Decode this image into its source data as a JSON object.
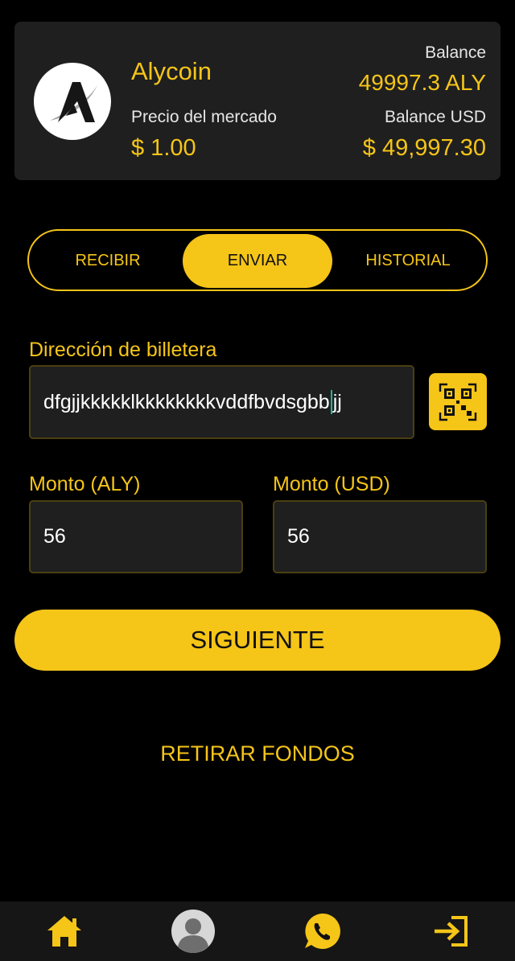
{
  "wallet": {
    "coin_name": "Alycoin",
    "market_price_label": "Precio del mercado",
    "market_price_value": "$ 1.00",
    "balance_label": "Balance",
    "balance_value": "49997.3 ALY",
    "balance_usd_label": "Balance USD",
    "balance_usd_value": "$ 49,997.30",
    "logo_icon": "alycoin-logo-icon"
  },
  "tabs": [
    {
      "label": "RECIBIR",
      "active": false
    },
    {
      "label": "ENVIAR",
      "active": true
    },
    {
      "label": "HISTORIAL",
      "active": false
    }
  ],
  "form": {
    "address_label": "Dirección de billetera",
    "address_before_caret": "dfgjjkkkkklkkkkkkkkvddfbvdsgbb",
    "address_after_caret": "jj",
    "qr_icon": "qr-code-icon",
    "amount_aly_label": "Monto (ALY)",
    "amount_aly_value": "56",
    "amount_usd_label": "Monto (USD)",
    "amount_usd_value": "56"
  },
  "actions": {
    "next_label": "SIGUIENTE",
    "withdraw_label": "RETIRAR FONDOS"
  },
  "bottom_nav": [
    {
      "icon": "home-icon"
    },
    {
      "icon": "profile-avatar-icon"
    },
    {
      "icon": "whatsapp-icon"
    },
    {
      "icon": "logout-icon"
    }
  ],
  "colors": {
    "accent": "#f5c518",
    "background": "#000000",
    "card": "#1f1f1f",
    "field_border": "#4a3f10"
  }
}
